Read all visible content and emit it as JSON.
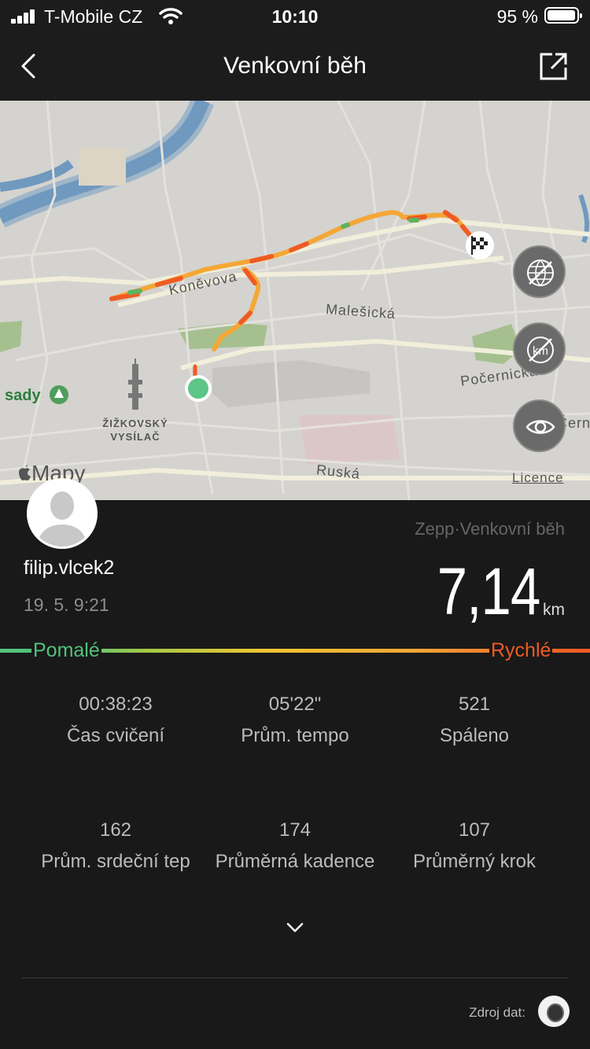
{
  "status_bar": {
    "carrier": "T-Mobile CZ",
    "time": "10:10",
    "battery": "95 %"
  },
  "nav": {
    "title": "Venkovní běh"
  },
  "map": {
    "labels": {
      "street1": "Koněvova",
      "street2": "Malešická",
      "street3": "Počernická",
      "street4": "Ruská",
      "street5": "Čern",
      "park": "sady",
      "tower": "ŽIŽKOVSKÝ VYSÍLAČ"
    },
    "mapy": "Mapy",
    "licence": "Licence"
  },
  "profile": {
    "username": "filip.vlcek2",
    "datetime": "19. 5. 9:21"
  },
  "workout": {
    "source_title": "Zepp·Venkovní běh",
    "distance": "7,14",
    "distance_unit": "km"
  },
  "speed_legend": {
    "slow": "Pomalé",
    "fast": "Rychlé",
    "slow_color": "#51c27a",
    "fast_color": "#ef5b24"
  },
  "stats": [
    {
      "value": "00:38:23",
      "label": "Čas cvičení"
    },
    {
      "value": "05'22\"",
      "label": "Prům. tempo"
    },
    {
      "value": "521",
      "label": "Spáleno"
    },
    {
      "value": "162",
      "label": "Prům. srdeční tep"
    },
    {
      "value": "174",
      "label": "Průměrná kadence"
    },
    {
      "value": "107",
      "label": "Průměrný krok"
    }
  ],
  "footer": {
    "data_source": "Zdroj dat:"
  }
}
